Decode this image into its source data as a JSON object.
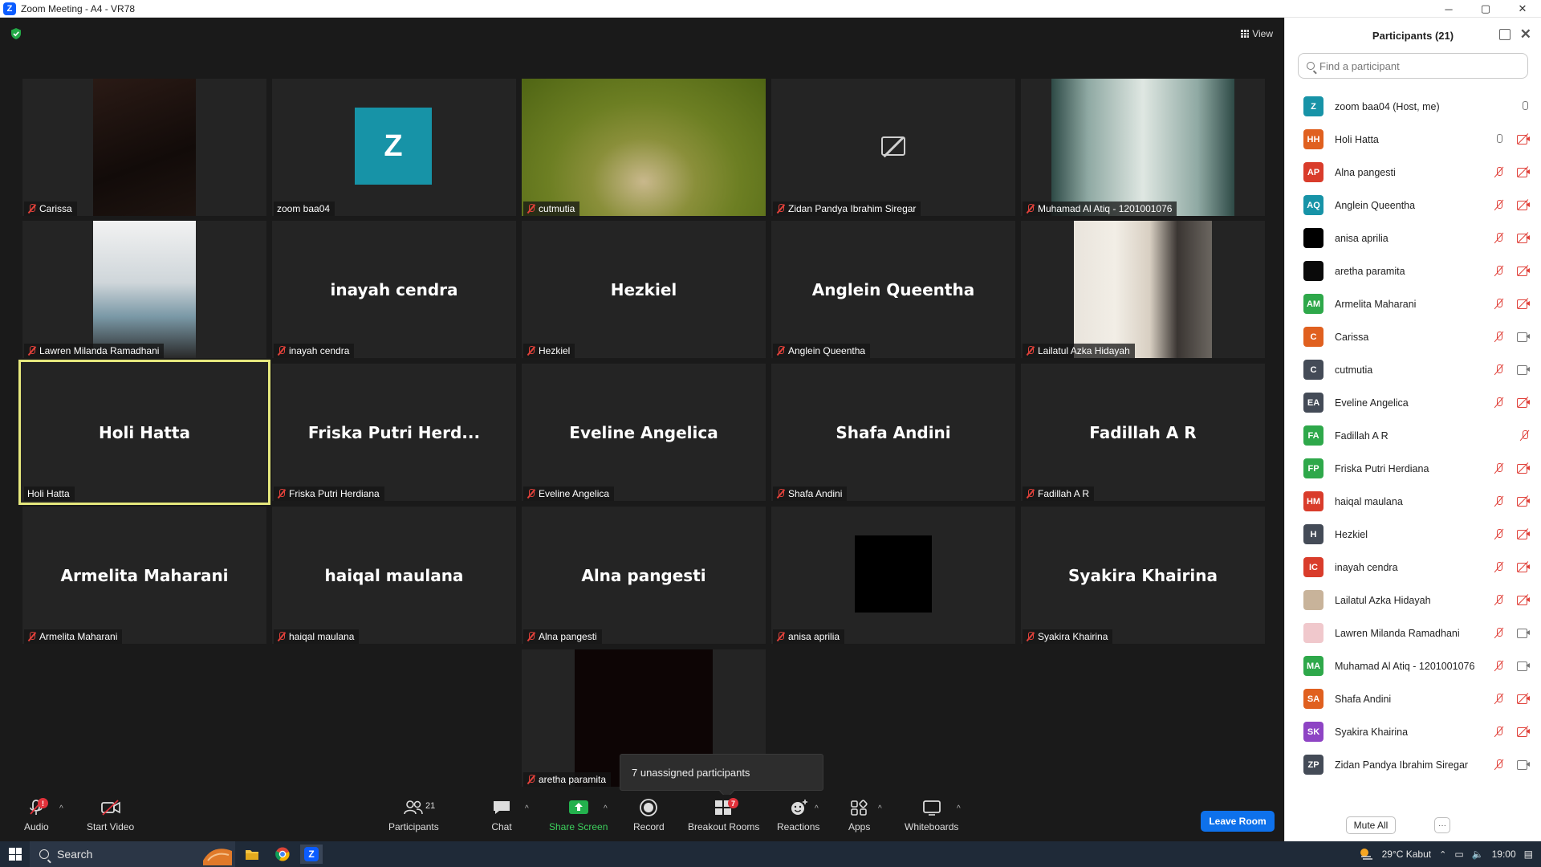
{
  "window": {
    "title": "Zoom Meeting - A4 - VR78",
    "minimize": "─",
    "maximize": "▢",
    "close": "✕"
  },
  "meeting": {
    "view_label": "View",
    "tiles": [
      {
        "name": "Carissa",
        "big": ""
      },
      {
        "name": "zoom baa04",
        "big": "",
        "avatar": "Z"
      },
      {
        "name": "cutmutia",
        "big": ""
      },
      {
        "name": "Zidan Pandya Ibrahim Siregar",
        "big": ""
      },
      {
        "name": "Muhamad Al Atiq - 1201001076",
        "big": ""
      },
      {
        "name": "Lawren Milanda Ramadhani",
        "big": ""
      },
      {
        "name": "inayah  cendra",
        "big": "inayah  cendra"
      },
      {
        "name": "Hezkiel",
        "big": "Hezkiel"
      },
      {
        "name": "Anglein Queentha",
        "big": "Anglein Queentha"
      },
      {
        "name": "Lailatul Azka Hidayah",
        "big": ""
      },
      {
        "name": "Holi Hatta",
        "big": "Holi Hatta"
      },
      {
        "name": "Friska Putri Herdiana",
        "big": "Friska Putri Herd..."
      },
      {
        "name": "Eveline Angelica",
        "big": "Eveline Angelica"
      },
      {
        "name": "Shafa Andini",
        "big": "Shafa Andini"
      },
      {
        "name": "Fadillah A R",
        "big": "Fadillah A R"
      },
      {
        "name": "Armelita Maharani",
        "big": "Armelita Maharani"
      },
      {
        "name": "haiqal maulana",
        "big": "haiqal maulana"
      },
      {
        "name": "Alna pangesti",
        "big": "Alna pangesti"
      },
      {
        "name": "anisa aprilia",
        "big": ""
      },
      {
        "name": "Syakira Khairina",
        "big": "Syakira Khairina"
      },
      {
        "name": "aretha paramita",
        "big": ""
      }
    ],
    "tooltip": "7 unassigned participants"
  },
  "toolbar": {
    "audio": "Audio",
    "audio_badge": "!",
    "start_video": "Start Video",
    "participants": "Participants",
    "participants_count": "21",
    "chat": "Chat",
    "share_screen": "Share Screen",
    "record": "Record",
    "breakout_rooms": "Breakout Rooms",
    "breakout_badge": "7",
    "reactions": "Reactions",
    "apps": "Apps",
    "whiteboards": "Whiteboards",
    "leave_room": "Leave Room",
    "caret": "^"
  },
  "panel": {
    "title": "Participants (21)",
    "search_placeholder": "Find a participant",
    "participants": [
      {
        "initials": "Z",
        "name": "zoom baa04 (Host, me)",
        "color": "#1793a7",
        "mic": "on",
        "cam": "none"
      },
      {
        "initials": "HH",
        "name": "Holi Hatta",
        "color": "#e0601f",
        "mic": "on",
        "cam": "off"
      },
      {
        "initials": "AP",
        "name": "Alna pangesti",
        "color": "#d93c2b",
        "mic": "off",
        "cam": "off"
      },
      {
        "initials": "AQ",
        "name": "Anglein Queentha",
        "color": "#1793a7",
        "mic": "off",
        "cam": "off"
      },
      {
        "initials": "",
        "name": "anisa aprilia",
        "color": "#000000",
        "mic": "off",
        "cam": "off"
      },
      {
        "initials": "",
        "name": "aretha paramita",
        "color": "#0a0a0a",
        "mic": "off",
        "cam": "off"
      },
      {
        "initials": "AM",
        "name": "Armelita Maharani",
        "color": "#2ea84a",
        "mic": "off",
        "cam": "off"
      },
      {
        "initials": "C",
        "name": "Carissa",
        "color": "#e0601f",
        "mic": "off",
        "cam": "on"
      },
      {
        "initials": "C",
        "name": "cutmutia",
        "color": "#444b57",
        "mic": "off",
        "cam": "on"
      },
      {
        "initials": "EA",
        "name": "Eveline Angelica",
        "color": "#444b57",
        "mic": "off",
        "cam": "off"
      },
      {
        "initials": "FA",
        "name": "Fadillah A R",
        "color": "#2ea84a",
        "mic": "off",
        "cam": "none"
      },
      {
        "initials": "FP",
        "name": "Friska Putri Herdiana",
        "color": "#2ea84a",
        "mic": "off",
        "cam": "off"
      },
      {
        "initials": "HM",
        "name": "haiqal maulana",
        "color": "#d93c2b",
        "mic": "off",
        "cam": "off"
      },
      {
        "initials": "H",
        "name": "Hezkiel",
        "color": "#444b57",
        "mic": "off",
        "cam": "off"
      },
      {
        "initials": "IC",
        "name": "inayah  cendra",
        "color": "#d93c2b",
        "mic": "off",
        "cam": "off"
      },
      {
        "initials": "",
        "name": "Lailatul Azka Hidayah",
        "color": "#c8b39a",
        "mic": "off",
        "cam": "off"
      },
      {
        "initials": "",
        "name": "Lawren Milanda Ramadhani",
        "color": "#f0c8cc",
        "mic": "off",
        "cam": "on"
      },
      {
        "initials": "MA",
        "name": "Muhamad Al Atiq - 1201001076",
        "color": "#2ea84a",
        "mic": "off",
        "cam": "on"
      },
      {
        "initials": "SA",
        "name": "Shafa Andini",
        "color": "#e0601f",
        "mic": "off",
        "cam": "off"
      },
      {
        "initials": "SK",
        "name": "Syakira Khairina",
        "color": "#8e44c4",
        "mic": "off",
        "cam": "off"
      },
      {
        "initials": "ZP",
        "name": "Zidan Pandya Ibrahim Siregar",
        "color": "#444b57",
        "mic": "off",
        "cam": "on"
      }
    ],
    "mute_all": "Mute All",
    "more": "···"
  },
  "taskbar": {
    "search": "Search",
    "weather": "29°C  Kabut",
    "time": "19:00"
  }
}
